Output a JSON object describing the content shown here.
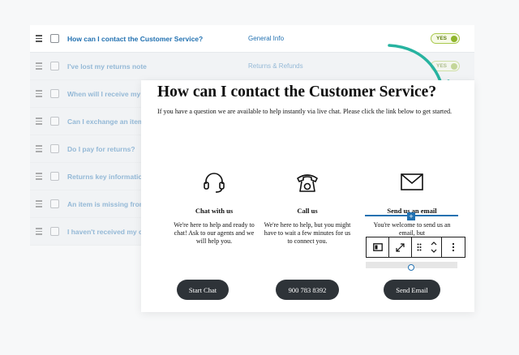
{
  "faq": {
    "rows": [
      {
        "question": "How can I contact the Customer Service?",
        "category": "General Info",
        "status": "YES"
      },
      {
        "question": "I've lost my returns note",
        "category": "Returns & Refunds",
        "status": "YES"
      },
      {
        "question": "When will I receive my refund?",
        "category": "",
        "status": ""
      },
      {
        "question": "Can I exchange an item?",
        "category": "",
        "status": ""
      },
      {
        "question": "Do I pay for returns?",
        "category": "",
        "status": ""
      },
      {
        "question": "Returns key information",
        "category": "",
        "status": ""
      },
      {
        "question": "An item is missing from my order",
        "category": "",
        "status": ""
      },
      {
        "question": "I haven't received my order",
        "category": "",
        "status": ""
      }
    ]
  },
  "card": {
    "title": "How can I contact the Customer Service?",
    "intro": "If you have a question we are available to help instantly via live chat. Please click the link below to get started.",
    "columns": [
      {
        "icon": "headset-icon",
        "title": "Chat with us",
        "text": "We're here to help and ready to chat! Ask to our agents and we will help you.",
        "button": "Start Chat"
      },
      {
        "icon": "phone-icon",
        "title": "Call us",
        "text": "We're here to help, but you might have to wait a few minutes for us to connect you.",
        "button": "900 783 8392"
      },
      {
        "icon": "mail-icon",
        "title": "Send us an email",
        "text": "You're welcome to send us an email, but",
        "button": "Send Email"
      }
    ]
  },
  "colors": {
    "accent": "#2271b1",
    "arrow": "#27b3a0",
    "button": "#2e3338",
    "toggle": "#8fb52c"
  }
}
